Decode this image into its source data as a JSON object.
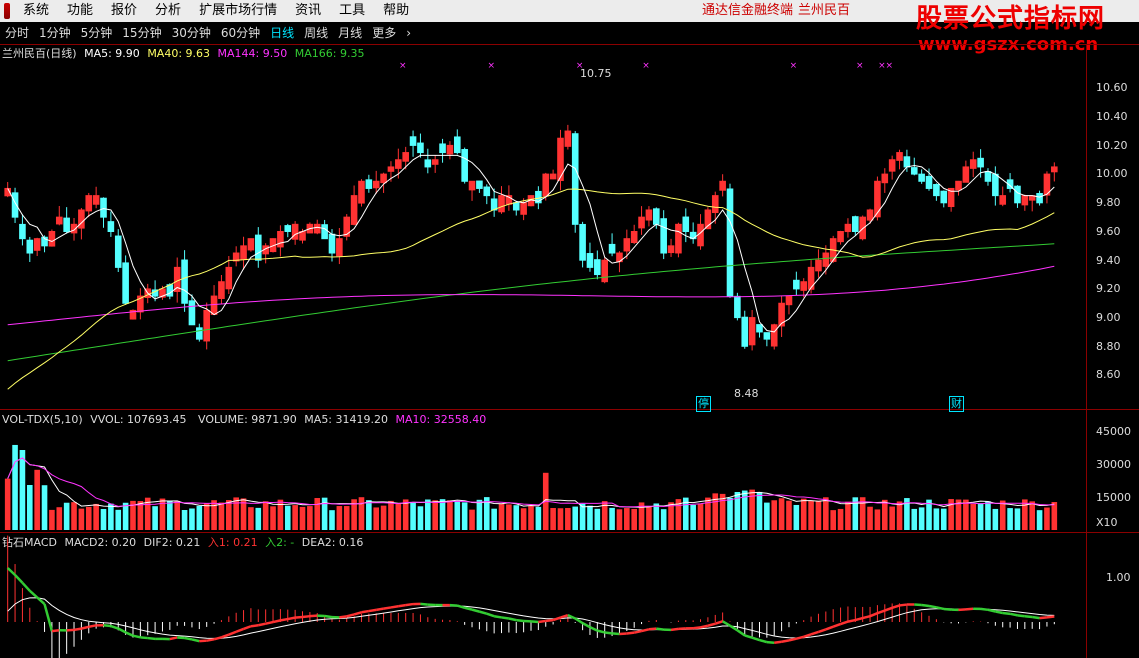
{
  "menu": {
    "items": [
      "系统",
      "功能",
      "报价",
      "分析",
      "扩展市场行情",
      "资讯",
      "工具",
      "帮助"
    ],
    "brand": "通达信金融终端",
    "stock_name": "兰州民百"
  },
  "watermark": {
    "line1": "股票公式指标网",
    "line2": "www.gszx.com.cn"
  },
  "periods": {
    "items": [
      "分时",
      "1分钟",
      "5分钟",
      "15分钟",
      "30分钟",
      "60分钟",
      "日线",
      "周线",
      "月线",
      "更多",
      "›"
    ],
    "active": "日线"
  },
  "price_panel": {
    "title": "兰州民百(日线)",
    "ma5": "MA5: 9.90",
    "ma40": "MA40: 9.63",
    "ma144": "MA144: 9.50",
    "ma166": "MA166: 9.35",
    "high_label": "10.75",
    "low_label": "8.48",
    "mark_ting": "停",
    "mark_cai": "财",
    "yticks": [
      "10.60",
      "10.40",
      "10.20",
      "10.00",
      "9.80",
      "9.60",
      "9.40",
      "9.20",
      "9.00",
      "8.80",
      "8.60"
    ]
  },
  "vol_panel": {
    "name": "VOL-TDX(5,10)",
    "vvol": "VVOL: 107693.45",
    "volume": "VOLUME: 9871.90",
    "ma5": "MA5: 31419.20",
    "ma10": "MA10: 32558.40",
    "yticks": [
      "45000",
      "30000",
      "15000"
    ],
    "unit": "X10"
  },
  "macd_panel": {
    "name": "钻石MACD",
    "macd2": "MACD2: 0.20",
    "dif2": "DIF2: 0.21",
    "in1": "入1: 0.21",
    "in2": "入2: -",
    "dea2": "DEA2: 0.16",
    "ytick": "1.00"
  },
  "colors": {
    "up": "#ff3232",
    "down": "#54ffff",
    "ma5": "#ffffff",
    "ma40": "#ffff66",
    "ma144": "#ff33ff",
    "ma166": "#33cc33",
    "grid": "#8b0000",
    "brand": "#cc0000"
  },
  "chart_data": {
    "type": "candlestick",
    "closes": [
      9.9,
      9.7,
      9.55,
      9.45,
      9.55,
      9.5,
      9.6,
      9.7,
      9.6,
      9.65,
      9.75,
      9.85,
      9.85,
      9.7,
      9.6,
      9.35,
      9.1,
      9.05,
      9.15,
      9.2,
      9.15,
      9.2,
      9.15,
      9.35,
      9.1,
      8.95,
      8.85,
      9.05,
      9.15,
      9.25,
      9.35,
      9.45,
      9.5,
      9.55,
      9.4,
      9.5,
      9.55,
      9.6,
      9.6,
      9.65,
      9.6,
      9.65,
      9.65,
      9.55,
      9.45,
      9.55,
      9.7,
      9.85,
      9.95,
      9.9,
      9.95,
      10.0,
      10.05,
      10.1,
      10.15,
      10.2,
      10.15,
      10.05,
      10.1,
      10.15,
      10.2,
      10.15,
      9.95,
      9.95,
      9.9,
      9.85,
      9.75,
      9.85,
      9.85,
      9.75,
      9.8,
      9.85,
      9.8,
      10.0,
      10.0,
      10.25,
      10.3,
      9.65,
      9.4,
      9.35,
      9.3,
      9.4,
      9.45,
      9.45,
      9.55,
      9.6,
      9.7,
      9.75,
      9.65,
      9.45,
      9.5,
      9.65,
      9.6,
      9.55,
      9.65,
      9.75,
      9.85,
      9.95,
      9.15,
      9.0,
      8.8,
      9.0,
      8.9,
      8.85,
      8.95,
      9.1,
      9.15,
      9.2,
      9.25,
      9.35,
      9.4,
      9.45,
      9.55,
      9.6,
      9.65,
      9.6,
      9.7,
      9.75,
      9.95,
      10.0,
      10.1,
      10.15,
      10.05,
      10.0,
      9.95,
      9.9,
      9.85,
      9.8,
      9.9,
      9.95,
      10.05,
      10.1,
      10.05,
      9.95,
      9.85,
      9.85,
      9.9,
      9.8,
      9.85,
      9.85,
      9.8,
      10.0,
      10.05
    ],
    "ma40_start": 8.5,
    "ma144_range": [
      8.95,
      9.5
    ],
    "ma166_range": [
      8.7,
      9.35
    ],
    "ylim": [
      8.48,
      10.75
    ],
    "volume_ylim": [
      0,
      50000
    ],
    "macd_ylim": [
      -0.9,
      1.3
    ]
  }
}
